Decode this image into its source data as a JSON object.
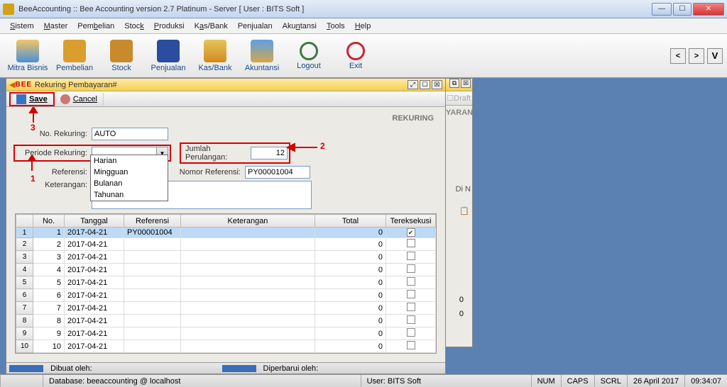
{
  "window": {
    "title": "BeeAccounting :: Bee Accounting version 2.7 Platinum - Server  [ User : BITS Soft ]"
  },
  "menu": [
    "Sistem",
    "Master",
    "Pembelian",
    "Stock",
    "Produksi",
    "Kas/Bank",
    "Penjualan",
    "Akuntansi",
    "Tools",
    "Help"
  ],
  "toolbar": {
    "mitra": "Mitra Bisnis",
    "pembelian": "Pembelian",
    "stock": "Stock",
    "penjualan": "Penjualan",
    "kasbank": "Kas/Bank",
    "akuntansi": "Akuntansi",
    "logout": "Logout",
    "exit": "Exit"
  },
  "panel": {
    "title": "Rekuring Pembayaran#",
    "save": "Save",
    "cancel": "Cancel",
    "section": "REKURING",
    "labels": {
      "no_rekuring": "No. Rekuring:",
      "periode": "Periode Rekuring:",
      "jumlah": "Jumlah Perulangan:",
      "referensi": "Referensi:",
      "nomor_ref": "Nomor Referensi:",
      "keterangan": "Keterangan:"
    },
    "values": {
      "no_rekuring": "AUTO",
      "periode": "",
      "jumlah": "12",
      "nomor_ref": "PY00001004"
    },
    "dropdown_options": [
      "Harian",
      "Mingguan",
      "Bulanan",
      "Tahunan"
    ],
    "annotations": {
      "n1": "1",
      "n2": "2",
      "n3": "3"
    }
  },
  "bgwin": {
    "draft": "Draft",
    "yaran": "YARAN",
    "din": "Di N",
    "zero": "0"
  },
  "table": {
    "headers": [
      "No.",
      "Tanggal",
      "Referensi",
      "Keterangan",
      "Total",
      "Tereksekusi"
    ],
    "rows": [
      {
        "no": "1",
        "tgl": "2017-04-21",
        "ref": "PY00001004",
        "ket": "",
        "total": "0",
        "chk": true
      },
      {
        "no": "2",
        "tgl": "2017-04-21",
        "ref": "",
        "ket": "",
        "total": "0",
        "chk": false
      },
      {
        "no": "3",
        "tgl": "2017-04-21",
        "ref": "",
        "ket": "",
        "total": "0",
        "chk": false
      },
      {
        "no": "4",
        "tgl": "2017-04-21",
        "ref": "",
        "ket": "",
        "total": "0",
        "chk": false
      },
      {
        "no": "5",
        "tgl": "2017-04-21",
        "ref": "",
        "ket": "",
        "total": "0",
        "chk": false
      },
      {
        "no": "6",
        "tgl": "2017-04-21",
        "ref": "",
        "ket": "",
        "total": "0",
        "chk": false
      },
      {
        "no": "7",
        "tgl": "2017-04-21",
        "ref": "",
        "ket": "",
        "total": "0",
        "chk": false
      },
      {
        "no": "8",
        "tgl": "2017-04-21",
        "ref": "",
        "ket": "",
        "total": "0",
        "chk": false
      },
      {
        "no": "9",
        "tgl": "2017-04-21",
        "ref": "",
        "ket": "",
        "total": "0",
        "chk": false
      },
      {
        "no": "10",
        "tgl": "2017-04-21",
        "ref": "",
        "ket": "",
        "total": "0",
        "chk": false
      }
    ]
  },
  "footer": {
    "dibuat": "Dibuat oleh:",
    "diperbarui": "Diperbarui oleh:"
  },
  "status": {
    "db": "Database: beeaccounting @ localhost",
    "user": "User: BITS Soft",
    "num": "NUM",
    "caps": "CAPS",
    "scrl": "SCRL",
    "date": "26 April 2017",
    "time": "09:34:07"
  }
}
